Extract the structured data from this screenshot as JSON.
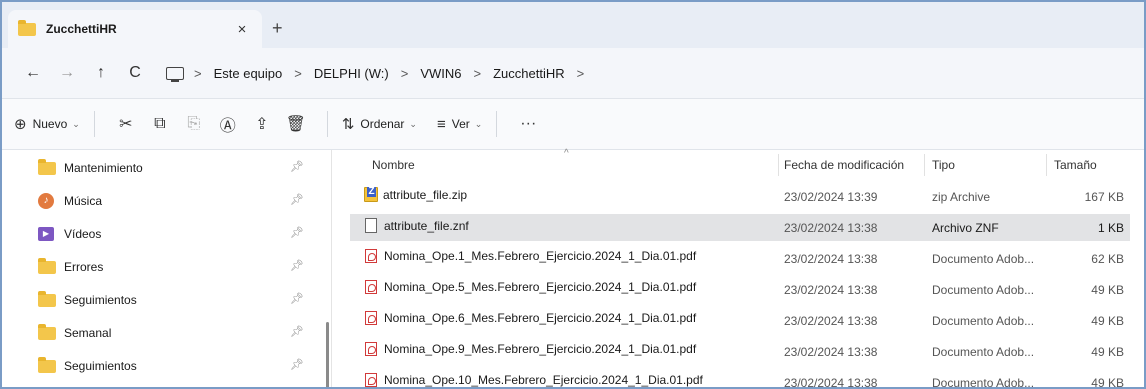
{
  "tab": {
    "title": "ZucchettiHR",
    "close_glyph": "×",
    "new_glyph": "+"
  },
  "nav": {
    "back_glyph": "←",
    "forward_glyph": "→",
    "up_glyph": "↑",
    "refresh_glyph": "C",
    "crumb_sep": ">",
    "breadcrumbs": [
      "Este equipo",
      "DELPHI (W:)",
      "VWIN6",
      "ZucchettiHR"
    ]
  },
  "commands": {
    "new_label": "Nuevo",
    "sort_label": "Ordenar",
    "view_label": "Ver",
    "more_glyph": "···"
  },
  "sidebar": {
    "items": [
      {
        "label": "Mantenimiento",
        "icon": "folder-icon"
      },
      {
        "label": "Música",
        "icon": "music-icon"
      },
      {
        "label": "Vídeos",
        "icon": "video-icon"
      },
      {
        "label": "Errores",
        "icon": "folder-icon"
      },
      {
        "label": "Seguimientos",
        "icon": "folder-icon"
      },
      {
        "label": "Semanal",
        "icon": "folder-icon"
      },
      {
        "label": "Seguimientos",
        "icon": "folder-icon"
      }
    ]
  },
  "columns": {
    "name": "Nombre",
    "date": "Fecha de modificación",
    "type": "Tipo",
    "size": "Tamaño"
  },
  "files": [
    {
      "name": "attribute_file.zip",
      "date": "23/02/2024 13:39",
      "type": "zip Archive",
      "size": "167 KB",
      "icon": "zip-icon"
    },
    {
      "name": "attribute_file.znf",
      "date": "23/02/2024 13:38",
      "type": "Archivo ZNF",
      "size": "1 KB",
      "icon": "file-icon"
    },
    {
      "name": "Nomina_Ope.1_Mes.Febrero_Ejercicio.2024_1_Dia.01.pdf",
      "date": "23/02/2024 13:38",
      "type": "Documento Adob...",
      "size": "62 KB",
      "icon": "pdf-icon"
    },
    {
      "name": "Nomina_Ope.5_Mes.Febrero_Ejercicio.2024_1_Dia.01.pdf",
      "date": "23/02/2024 13:38",
      "type": "Documento Adob...",
      "size": "49 KB",
      "icon": "pdf-icon"
    },
    {
      "name": "Nomina_Ope.6_Mes.Febrero_Ejercicio.2024_1_Dia.01.pdf",
      "date": "23/02/2024 13:38",
      "type": "Documento Adob...",
      "size": "49 KB",
      "icon": "pdf-icon"
    },
    {
      "name": "Nomina_Ope.9_Mes.Febrero_Ejercicio.2024_1_Dia.01.pdf",
      "date": "23/02/2024 13:38",
      "type": "Documento Adob...",
      "size": "49 KB",
      "icon": "pdf-icon"
    },
    {
      "name": "Nomina_Ope.10_Mes.Febrero_Ejercicio.2024_1_Dia.01.pdf",
      "date": "23/02/2024 13:38",
      "type": "Documento Adob...",
      "size": "49 KB",
      "icon": "pdf-icon"
    }
  ],
  "selected_index": 1,
  "colors": {
    "accent_border": "#7a9cc6",
    "selected_row": "#e2e3e5",
    "folder": "#f3c64b",
    "pdf": "#d13a3a"
  }
}
